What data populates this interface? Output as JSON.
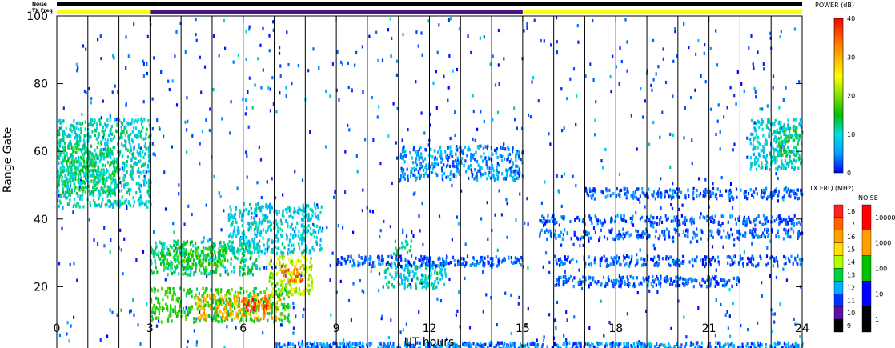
{
  "chart_data": {
    "type": "heatmap",
    "top_labels": {
      "noise": "Noise",
      "tx_freq": "TX Freq"
    },
    "tx_freq_bar": [
      {
        "start": 0,
        "end": 3,
        "color": "#ffff00"
      },
      {
        "start": 3,
        "end": 15,
        "color": "#4b1480"
      },
      {
        "start": 15,
        "end": 24,
        "color": "#ffff00"
      }
    ],
    "noise_bar_color": "#000000",
    "xlabel": "UT hours",
    "ylabel": "Range Gate",
    "xlim": [
      0,
      24
    ],
    "ylim": [
      0,
      100
    ],
    "xticks": [
      "0",
      "3",
      "6",
      "9",
      "12",
      "15",
      "18",
      "21",
      "24"
    ],
    "yticks": [
      "0",
      "20",
      "40",
      "60",
      "80",
      "100"
    ],
    "scan_boundaries_hours": [
      1,
      2,
      3,
      4,
      5,
      6,
      7,
      8,
      9,
      10,
      11,
      12,
      13,
      14,
      15,
      16,
      17,
      18,
      19,
      20,
      21,
      22,
      23
    ],
    "echo_regions": [
      {
        "t0": 0.0,
        "t1": 3.0,
        "g0": 44,
        "g1": 70,
        "level": 10
      },
      {
        "t0": 0.0,
        "t1": 2.0,
        "g0": 48,
        "g1": 62,
        "level": 13
      },
      {
        "t0": 3.0,
        "t1": 6.5,
        "g0": 24,
        "g1": 34,
        "level": 12
      },
      {
        "t0": 3.3,
        "t1": 5.5,
        "g0": 26,
        "g1": 32,
        "level": 17
      },
      {
        "t0": 3.0,
        "t1": 7.5,
        "g0": 10,
        "g1": 20,
        "level": 16
      },
      {
        "t0": 4.5,
        "t1": 7.2,
        "g0": 11,
        "g1": 18,
        "level": 30
      },
      {
        "t0": 6.0,
        "t1": 6.8,
        "g0": 13,
        "g1": 17,
        "level": 37
      },
      {
        "t0": 6.8,
        "t1": 8.2,
        "g0": 18,
        "g1": 30,
        "level": 22
      },
      {
        "t0": 7.2,
        "t1": 7.9,
        "g0": 22,
        "g1": 27,
        "level": 34
      },
      {
        "t0": 5.5,
        "t1": 8.5,
        "g0": 30,
        "g1": 45,
        "level": 9
      },
      {
        "t0": 10.5,
        "t1": 12.5,
        "g0": 20,
        "g1": 28,
        "level": 10
      },
      {
        "t0": 10.8,
        "t1": 11.4,
        "g0": 30,
        "g1": 34,
        "level": 12
      },
      {
        "t0": 11.0,
        "t1": 15.0,
        "g0": 52,
        "g1": 62,
        "level": 5
      },
      {
        "t0": 22.3,
        "t1": 24.0,
        "g0": 55,
        "g1": 70,
        "level": 9
      },
      {
        "t0": 23.2,
        "t1": 23.9,
        "g0": 58,
        "g1": 68,
        "level": 14
      }
    ],
    "colorbars": {
      "power": {
        "title": "POWER (dB)",
        "ticks": [
          "40",
          "30",
          "20",
          "10",
          "0"
        ],
        "range": [
          0,
          40
        ],
        "stops": [
          "#0000ff",
          "#00a0ff",
          "#00e0e0",
          "#00c000",
          "#80e000",
          "#ffff00",
          "#ffb000",
          "#ff6000",
          "#ff0000"
        ]
      },
      "tx_freq": {
        "title": "TX FRQ (MHz)",
        "labels": [
          "18",
          "17",
          "16",
          "15",
          "14",
          "13",
          "12",
          "11",
          "10",
          "9"
        ],
        "colors": [
          "#ff2020",
          "#ff6000",
          "#ffa000",
          "#ffe000",
          "#b0ff00",
          "#00d040",
          "#00b0ff",
          "#0030ff",
          "#6010a0",
          "#000000"
        ]
      },
      "noise": {
        "title": "NOISE",
        "labels": [
          "10000",
          "1000",
          "100",
          "10",
          "1"
        ],
        "colors": [
          "#ff0000",
          "#ffa000",
          "#00c000",
          "#0000ff",
          "#000000"
        ]
      }
    }
  }
}
